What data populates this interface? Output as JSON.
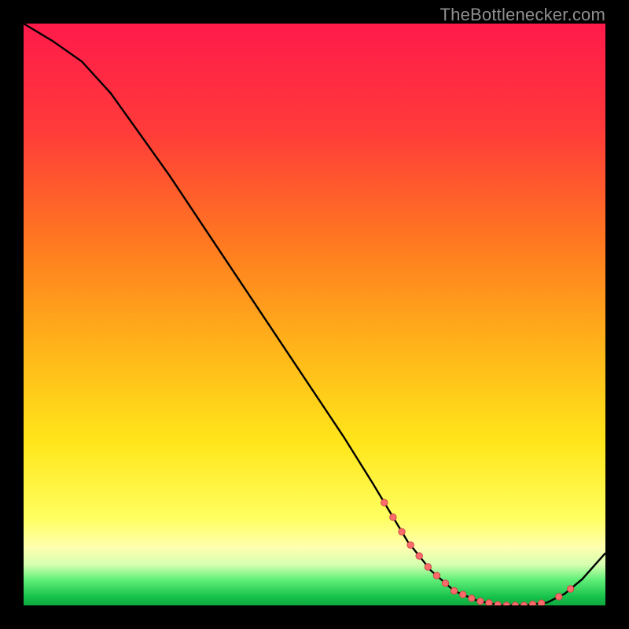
{
  "attribution": "TheBottlenecker.com",
  "colors": {
    "red_top": "#ff1a4b",
    "orange_mid": "#ff8a1f",
    "yellow": "#ffe61a",
    "pale_yellow": "#ffffa5",
    "green_band_light": "#63f07a",
    "green_band_dark": "#17c24b",
    "curve": "#000000",
    "dot_fill": "#ff6b6b",
    "dot_stroke": "#c84a4a"
  },
  "gradient_stops": [
    {
      "offset": 0.0,
      "color": "#ff1a4b"
    },
    {
      "offset": 0.18,
      "color": "#ff3a3a"
    },
    {
      "offset": 0.38,
      "color": "#ff7a20"
    },
    {
      "offset": 0.55,
      "color": "#ffb21a"
    },
    {
      "offset": 0.72,
      "color": "#ffe61a"
    },
    {
      "offset": 0.85,
      "color": "#ffff60"
    },
    {
      "offset": 0.9,
      "color": "#ffffb0"
    },
    {
      "offset": 0.93,
      "color": "#d6ffb0"
    },
    {
      "offset": 0.955,
      "color": "#63f07a"
    },
    {
      "offset": 0.985,
      "color": "#17c24b"
    },
    {
      "offset": 1.0,
      "color": "#0fa83e"
    }
  ],
  "chart_data": {
    "type": "line",
    "x": [
      0,
      5,
      10,
      15,
      20,
      25,
      30,
      35,
      40,
      45,
      50,
      55,
      60,
      63,
      66,
      70,
      74,
      78,
      82,
      86,
      90,
      93,
      96,
      100
    ],
    "y": [
      100,
      97,
      93.5,
      88,
      81,
      74,
      66.5,
      59,
      51.5,
      44,
      36.5,
      29,
      21,
      16,
      11,
      6,
      2.5,
      0.8,
      0,
      0,
      0.5,
      2,
      4.5,
      9
    ],
    "title": "",
    "xlabel": "",
    "ylabel": "",
    "xlim": [
      0,
      100
    ],
    "ylim": [
      0,
      100
    ],
    "dots_x": [
      62,
      63.5,
      65,
      66.5,
      68,
      69.5,
      71,
      72.5,
      74,
      75.5,
      77,
      78.5,
      80,
      81.5,
      83,
      84.5,
      86,
      87.5,
      89,
      92,
      94
    ],
    "dot_radius": 4.2
  }
}
